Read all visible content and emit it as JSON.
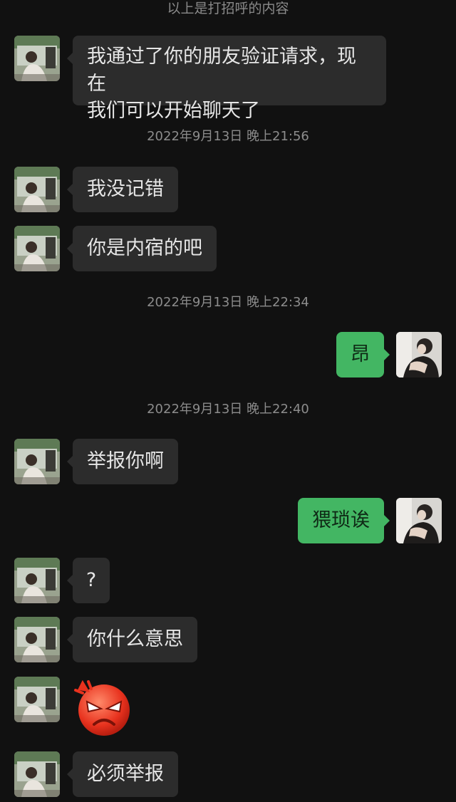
{
  "system_notice": "以上是打招呼的内容",
  "timestamps": [
    "2022年9月13日 晚上21:56",
    "2022年9月13日 晚上22:34",
    "2022年9月13日 晚上22:40"
  ],
  "messages": [
    {
      "from": "other",
      "lines": [
        "我通过了你的朋友验证请求，现在",
        "我们可以开始聊天了"
      ]
    },
    {
      "from": "other",
      "text": "我没记错"
    },
    {
      "from": "other",
      "text": "你是内宿的吧"
    },
    {
      "from": "me",
      "text": "昂"
    },
    {
      "from": "other",
      "text": "举报你啊"
    },
    {
      "from": "me",
      "text": "猥琐诶"
    },
    {
      "from": "other",
      "text": "?"
    },
    {
      "from": "other",
      "text": "你什么意思"
    },
    {
      "from": "other",
      "sticker": "angry-face-emoji"
    },
    {
      "from": "other",
      "text": "必须举报"
    }
  ],
  "colors": {
    "background": "#111111",
    "incoming_bubble": "#2c2c2c",
    "outgoing_bubble": "#43b663",
    "timestamp_text": "#8c8c8c"
  }
}
